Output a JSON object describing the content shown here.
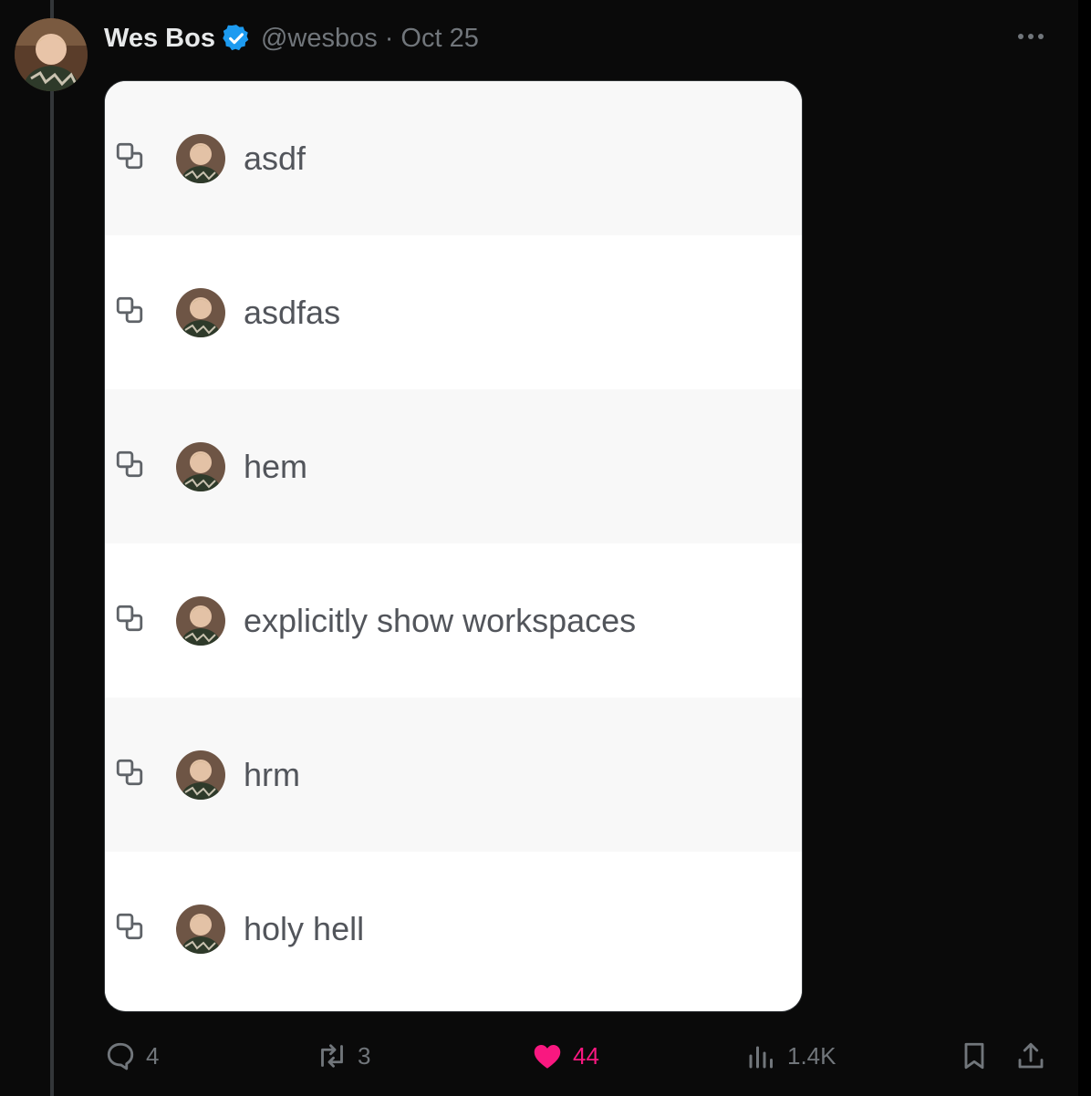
{
  "post": {
    "author_name": "Wes Bos",
    "handle": "@wesbos",
    "separator": "·",
    "date": "Oct 25"
  },
  "colors": {
    "verified": "#1d9bf0",
    "like": "#f91880",
    "muted": "#71767b"
  },
  "card": {
    "rows": [
      {
        "title": "asdf"
      },
      {
        "title": "asdfas"
      },
      {
        "title": "hem"
      },
      {
        "title": "explicitly show workspaces"
      },
      {
        "title": "hrm"
      },
      {
        "title": "holy hell"
      }
    ]
  },
  "actions": {
    "replies": "4",
    "reposts": "3",
    "likes": "44",
    "views": "1.4K"
  }
}
